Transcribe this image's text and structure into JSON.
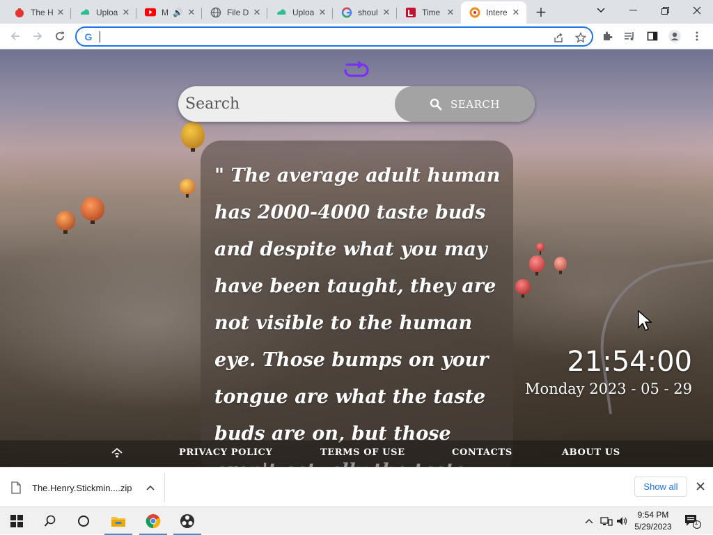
{
  "browser": {
    "tabs": [
      {
        "title": "The H",
        "icon": "red-logo-icon"
      },
      {
        "title": "Uploa",
        "icon": "green-cloud-icon"
      },
      {
        "title": "M",
        "icon": "youtube-icon"
      },
      {
        "title": "File D",
        "icon": "globe-icon"
      },
      {
        "title": "Uploa",
        "icon": "green-cloud-icon"
      },
      {
        "title": "shoul",
        "icon": "google-icon"
      },
      {
        "title": "Time",
        "icon": "red-l-icon"
      },
      {
        "title": "Intere",
        "icon": "orange-ring-icon"
      }
    ],
    "address_value": "",
    "address_letter": "G"
  },
  "page": {
    "search": {
      "placeholder": "Search",
      "button_label": "SEARCH"
    },
    "quote": {
      "text": "\"  The average adult human has 2000-4000 taste buds and despite what you may have been taught, they are not visible to the human eye. Those bumps on your tongue are what the taste buds are on, but those aren't actually the taste buds themselves.  \""
    },
    "clock": {
      "time": "21:54:00",
      "date": "Monday 2023 - 05 - 29"
    },
    "footer": {
      "links": [
        "PRIVACY POLICY",
        "TERMS OF USE",
        "CONTACTS",
        "ABOUT US"
      ]
    }
  },
  "downloads": {
    "file_name": "The.Henry.Stickmin....zip",
    "show_all_label": "Show all"
  },
  "taskbar": {
    "time": "9:54 PM",
    "date": "5/29/2023",
    "notification_count": "1"
  },
  "colors": {
    "accent": "#1a73e8",
    "logo": "#7b2ff7"
  }
}
